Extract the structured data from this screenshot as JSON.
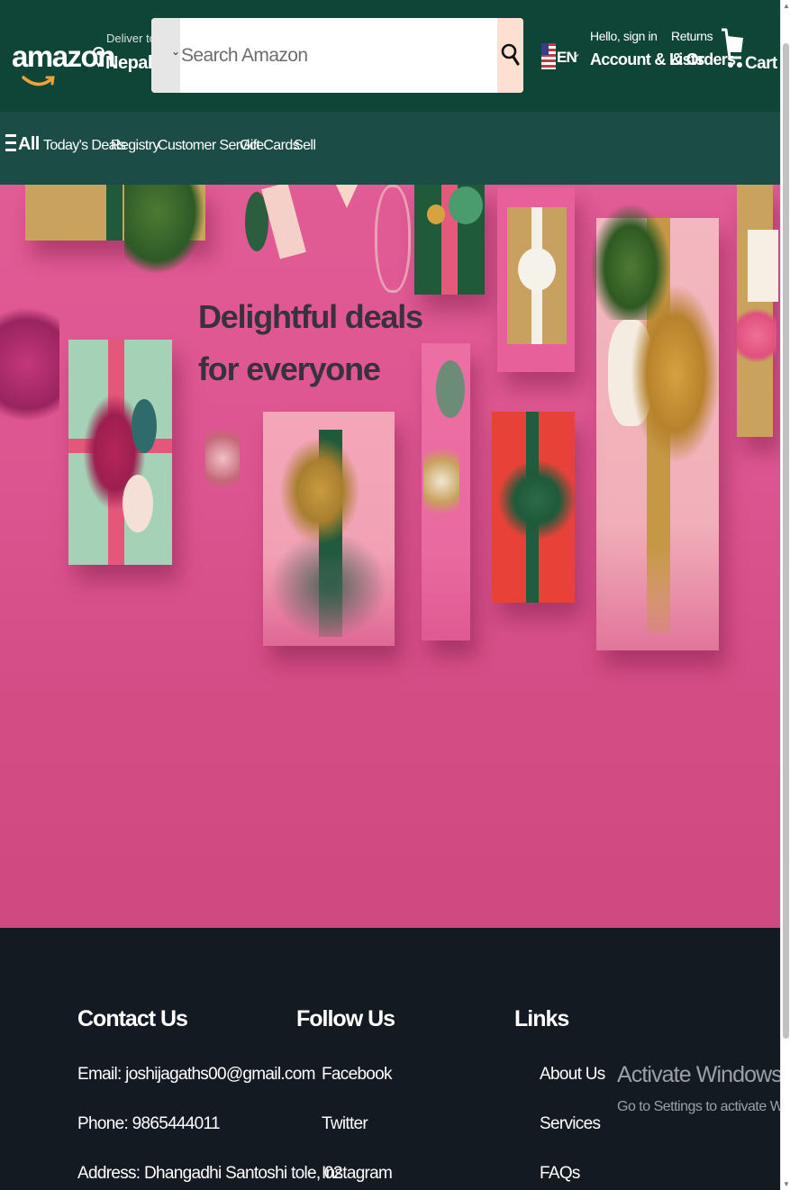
{
  "header": {
    "logo": "amazon",
    "deliver_to_label": "Deliver to",
    "deliver_to_location": "Nepal",
    "search_placeholder": "Search Amazon",
    "language": "EN",
    "account_greeting": "Hello, sign in",
    "account_label": "Account & Lists",
    "returns_label": "Returns",
    "orders_label": "& Orders",
    "cart_label": "Cart"
  },
  "nav": {
    "all_label": "All",
    "items": [
      "Today's Deals",
      "Registry",
      "Customer Service",
      "Gift Cards",
      "Sell"
    ]
  },
  "hero": {
    "headline_line1": "Delightful deals",
    "headline_line2": "for everyone"
  },
  "footer": {
    "contact": {
      "title": "Contact Us",
      "email": "Email: joshijagaths00@gmail.com",
      "phone": "Phone: 9865444011",
      "address": "Address: Dhangadhi Santoshi tole, 02"
    },
    "follow": {
      "title": "Follow Us",
      "items": [
        "Facebook",
        "Twitter",
        "Instagram"
      ]
    },
    "links": {
      "title": "Links",
      "items": [
        "About Us",
        "Services",
        "FAQs"
      ]
    }
  },
  "watermark": {
    "title": "Activate Windows",
    "subtitle": "Go to Settings to activate Windows."
  },
  "colors": {
    "header_bg": "#0f4537",
    "nav_bg": "#1b4d46",
    "hero_bg": "#d14a7e",
    "footer_bg": "#141a22",
    "search_button": "#fde0d2"
  },
  "icons": [
    "location-pin-icon",
    "search-icon",
    "us-flag-icon",
    "cart-icon",
    "menu-icon",
    "chevron-down-icon"
  ]
}
